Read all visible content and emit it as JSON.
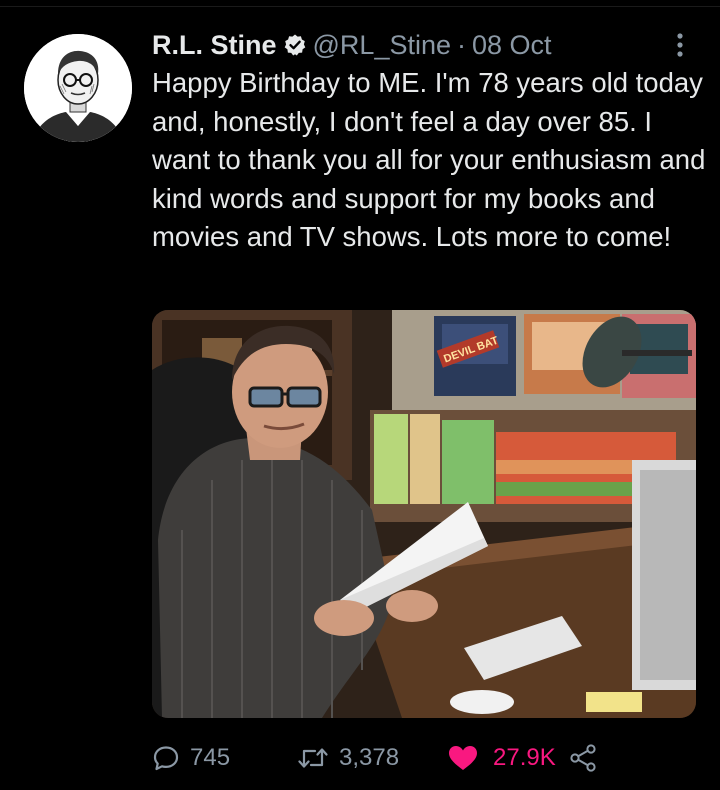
{
  "tweet": {
    "author": {
      "display_name": "R.L. Stine",
      "handle": "@RL_Stine",
      "verified": true,
      "avatar_icon": "portrait-illustration-icon"
    },
    "separator": "·",
    "date": "08 Oct",
    "text": "Happy Birthday to ME. I'm 78 years old today and, honestly, I don't feel a day over 85. I want to thank you all for your enthusiasm and kind words and support for my books and movies and TV shows. Lots more to come!",
    "media": {
      "poster_text": "DEVIL BAT"
    },
    "stats": {
      "replies": "745",
      "retweets": "3,378",
      "likes": "27.9K",
      "liked": true
    }
  },
  "icons": {
    "verified": "verified-badge-icon",
    "more": "more-vertical-icon",
    "reply": "reply-bubble-icon",
    "retweet": "retweet-icon",
    "like": "heart-icon",
    "share": "share-icon"
  },
  "colors": {
    "background": "#000000",
    "text_primary": "#e7e9ea",
    "text_secondary": "#8b98a5",
    "like_active": "#f91880",
    "verified_badge": "#e7e9ea"
  }
}
